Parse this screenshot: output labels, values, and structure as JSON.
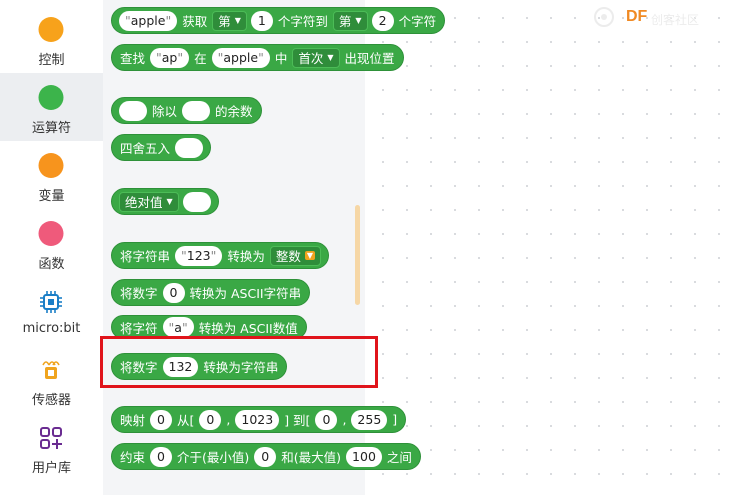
{
  "sidebar": {
    "items": [
      {
        "label": "控制",
        "color": "#f7a21b",
        "active": false
      },
      {
        "label": "运算符",
        "color": "#3cb44b",
        "active": true
      },
      {
        "label": "变量",
        "color": "#f7941d",
        "active": false
      },
      {
        "label": "函数",
        "color": "#ef5a7b",
        "active": false
      },
      {
        "label": "micro:bit",
        "icon": "chip-icon",
        "active": false
      },
      {
        "label": "传感器",
        "icon": "sensor-icon",
        "active": false
      },
      {
        "label": "用户库",
        "icon": "user-library-icon",
        "active": false
      }
    ]
  },
  "blocks": {
    "substring": {
      "str": "apple",
      "get": "获取",
      "from_dd": "第",
      "from_n": "1",
      "to_text": "个字符到",
      "to_dd": "第",
      "to_n": "2",
      "end": "个字符"
    },
    "find": {
      "find": "查找",
      "sub": "ap",
      "in": "在",
      "str": "apple",
      "mid": "中",
      "dd": "首次",
      "end": "出现位置"
    },
    "mod": {
      "text": "除以",
      "end": "的余数"
    },
    "round": {
      "text": "四舍五入"
    },
    "abs": {
      "dd": "绝对值"
    },
    "str_to_num": {
      "a": "将字符串",
      "val": "123",
      "b": "转换为",
      "dd": "整数"
    },
    "num_to_ascii": {
      "a": "将数字",
      "val": "0",
      "b": "转换为 ASCII字符串"
    },
    "char_to_ascii": {
      "a": "将字符",
      "val": "a",
      "b": "转换为 ASCII数值"
    },
    "num_to_str": {
      "a": "将数字",
      "val": "132",
      "b": "转换为字符串"
    },
    "map": {
      "a": "映射",
      "v": "0",
      "from": "从[",
      "f1": "0",
      "comma1": ",",
      "f2": "1023",
      "to": "] 到[",
      "t1": "0",
      "comma2": ",",
      "t2": "255",
      "end": "]"
    },
    "constrain": {
      "a": "约束",
      "v": "0",
      "b": "介于(最小值)",
      "min": "0",
      "c": "和(最大值)",
      "max": "100",
      "d": "之间"
    }
  },
  "logo": {
    "text": "DF",
    "subtext": "创客社区"
  },
  "colors": {
    "block": "#3aa845",
    "highlight": "#e0141b",
    "flyout": "#f4f5f7"
  }
}
